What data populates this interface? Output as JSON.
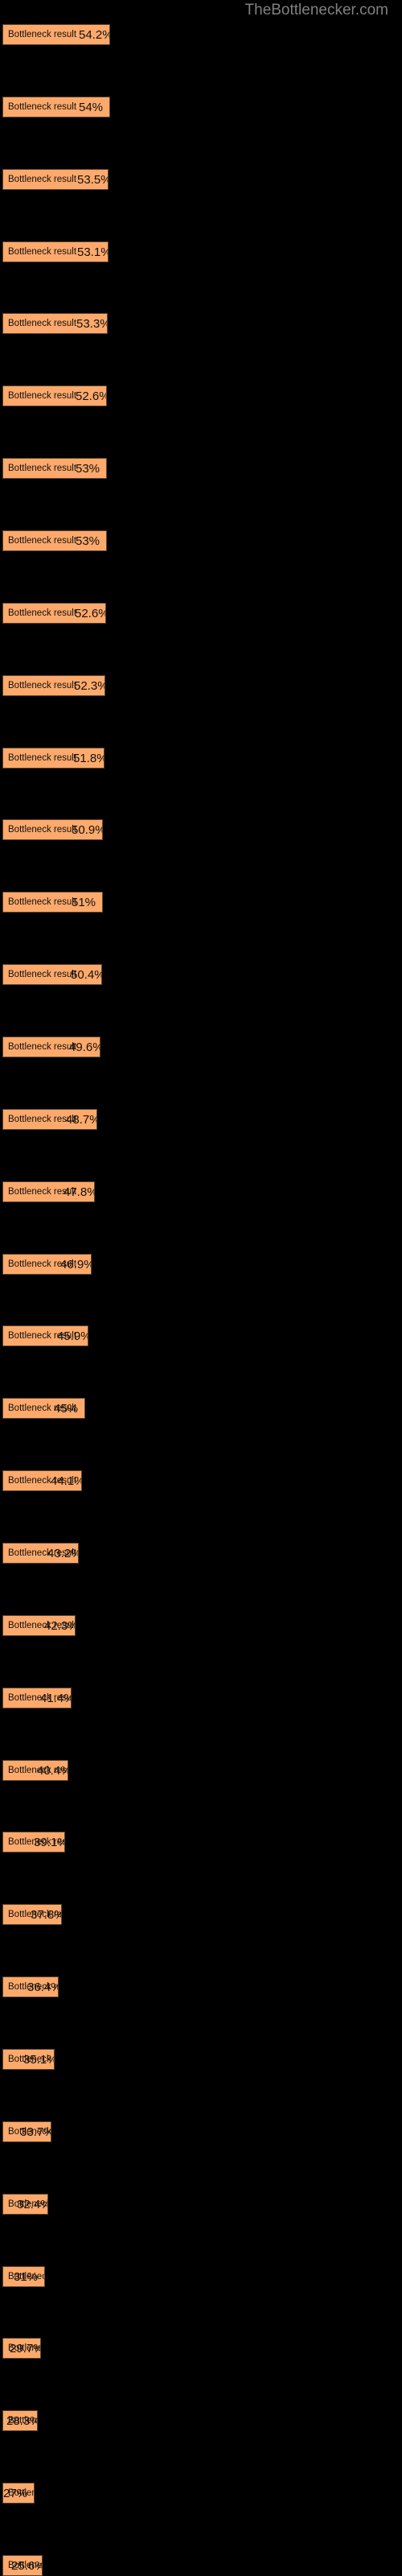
{
  "watermark": "TheBottlenecker.com",
  "colors": {
    "background": "#000000",
    "bar_fill": "#fca96b",
    "bar_border": "#57422c",
    "bar_text": "#111111",
    "watermark_text": "#808080"
  },
  "chart_data": {
    "type": "bar",
    "orientation": "horizontal",
    "title": "",
    "subtitle": "",
    "xlabel": "",
    "ylabel": "",
    "grid": false,
    "legend": null,
    "axis_visible": false,
    "xlim": [
      0,
      60
    ],
    "value_suffix": "%",
    "note": "Each bar is labelled 'Bottleneck result'; the numeric value is drawn inside the bar at its right end and is clipped by the bar edge for shorter bars.",
    "categories": [
      "Bottleneck result",
      "Bottleneck result",
      "Bottleneck result",
      "Bottleneck result",
      "Bottleneck result",
      "Bottleneck result",
      "Bottleneck result",
      "Bottleneck result",
      "Bottleneck result",
      "Bottleneck result",
      "Bottleneck result",
      "Bottleneck result",
      "Bottleneck result",
      "Bottleneck result",
      "Bottleneck result",
      "Bottleneck result",
      "Bottleneck result",
      "Bottleneck result",
      "Bottleneck result",
      "Bottleneck result",
      "Bottleneck result",
      "Bottleneck result",
      "Bottleneck result",
      "Bottleneck result",
      "Bottleneck result",
      "Bottleneck result",
      "Bottleneck result",
      "Bottleneck result",
      "Bottleneck result",
      "Bottleneck result",
      "Bottleneck result",
      "Bottleneck result",
      "Bottleneck result",
      "Bottleneck result",
      "Bottleneck result",
      "Bottleneck result"
    ],
    "values": [
      54.2,
      54.0,
      53.5,
      53.1,
      53.3,
      52.6,
      53.0,
      53.0,
      52.6,
      52.3,
      51.8,
      50.9,
      51.0,
      50.4,
      49.6,
      48.7,
      47.8,
      46.9,
      45.9,
      45.0,
      44.1,
      43.2,
      42.3,
      41.4,
      40.4,
      39.1,
      37.8,
      36.4,
      35.1,
      33.7,
      32.4,
      31.0,
      29.7,
      28.3,
      27.0,
      25.6
    ],
    "value_labels": [
      "54.2%",
      "54%",
      "53.5%",
      "53.1%",
      "53.3%",
      "52.6%",
      "53%",
      "53%",
      "52.6%",
      "52.3%",
      "51.8%",
      "50.9%",
      "51%",
      "50.4%",
      "49.6%",
      "48.7%",
      "47.8%",
      "46.9%",
      "45.9%",
      "45%",
      "44.1%",
      "43.2%",
      "42.3%",
      "41.4%",
      "40.4%",
      "39.1%",
      "37.8%",
      "36.4%",
      "35.1%",
      "33.7%",
      "32.4%",
      "31%",
      "29.7%",
      "28.3%",
      "27%",
      "25.6%"
    ],
    "bar_pixel_widths": [
      134,
      134,
      132,
      132,
      131,
      130,
      130,
      130,
      129,
      128,
      127,
      125,
      125,
      124,
      122,
      118,
      115,
      111,
      107,
      103,
      99,
      95,
      91,
      86,
      82,
      78,
      74,
      70,
      65,
      61,
      57,
      53,
      48,
      44,
      40,
      50
    ]
  }
}
